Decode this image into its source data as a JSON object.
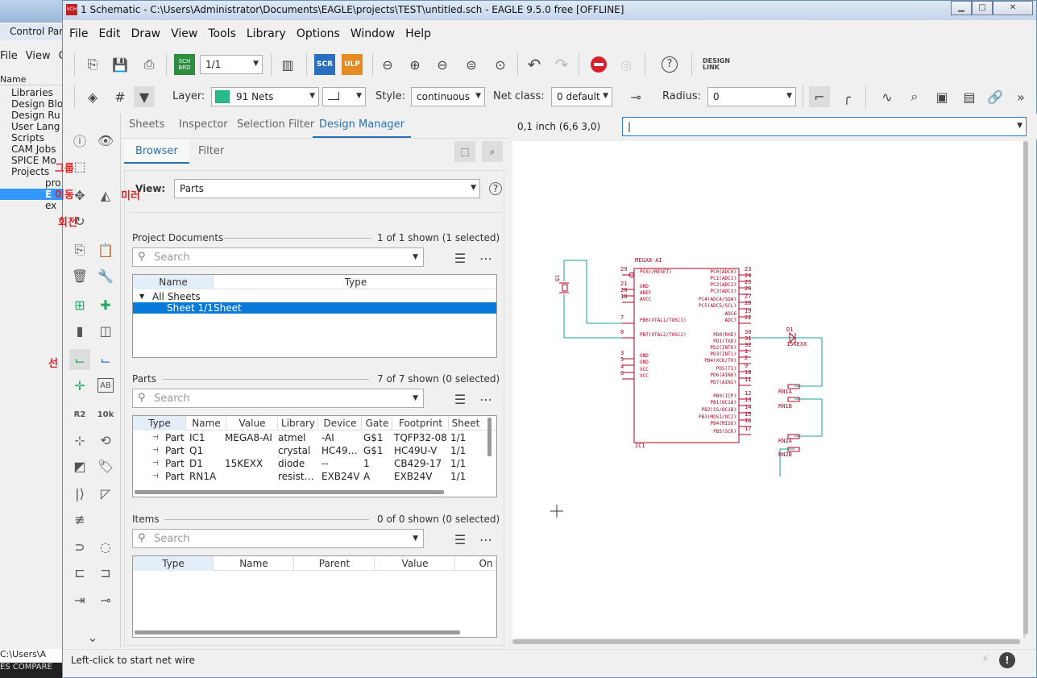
{
  "background_window": {
    "tab_label": "Control Par",
    "menu": [
      "File",
      "View",
      "G"
    ],
    "column_header": "Name",
    "tree": [
      "Libraries",
      "Design Blo",
      "Design Ru",
      "User Lang",
      "Scripts",
      "CAM Jobs",
      "SPICE Mo",
      "Projects",
      "pro",
      "E",
      "ex"
    ],
    "bottom_path": "C:\\Users\\A",
    "bottom_bar": "ES  COMPARE"
  },
  "korean_annotations": {
    "group": "그룹",
    "move": "이동",
    "mirror": "미러",
    "rotate": "회전",
    "line": "선"
  },
  "window": {
    "title": "1 Schematic - C:\\Users\\Administrator\\Documents\\EAGLE\\projects\\TEST\\untitled.sch - EAGLE 9.5.0 free [OFFLINE]",
    "icon_text": "SCH"
  },
  "menubar": [
    "File",
    "Edit",
    "Draw",
    "View",
    "Tools",
    "Library",
    "Options",
    "Window",
    "Help"
  ],
  "toolbar1": {
    "sheet_combo": "1/1",
    "scr_label": "SCR",
    "ulp_label": "ULP",
    "sch_brd_label": "SCH BRD",
    "design_link_label": "DESIGN LINK"
  },
  "toolbar2": {
    "layer_label": "Layer:",
    "layer_value": "91 Nets",
    "layer_color": "#2bbb8a",
    "style_label": "Style:",
    "style_value": "continuous",
    "netclass_label": "Net class:",
    "netclass_value": "0 default",
    "radius_label": "Radius:",
    "radius_value": "0"
  },
  "panel": {
    "tabs": [
      "Sheets",
      "Inspector",
      "Selection Filter",
      "Design Manager"
    ],
    "subtabs": [
      "Browser",
      "Filter"
    ],
    "view_label": "View:",
    "view_value": "Parts",
    "project_documents": {
      "title": "Project Documents",
      "count": "1 of 1 shown (1 selected)",
      "search_placeholder": "Search",
      "columns": [
        "Name",
        "Type"
      ],
      "rows": [
        {
          "name": "All Sheets"
        },
        {
          "name": "Sheet 1/1",
          "type": "Sheet"
        }
      ]
    },
    "parts": {
      "title": "Parts",
      "count": "7 of 7 shown (0 selected)",
      "search_placeholder": "Search",
      "columns": [
        "Type",
        "Name",
        "Value",
        "Library",
        "Device",
        "Gate",
        "Footprint",
        "Sheet"
      ],
      "rows": [
        {
          "type": "Part",
          "name": "IC1",
          "value": "MEGA8-AI",
          "library": "atmel",
          "device": "-AI",
          "gate": "G$1",
          "footprint": "TQFP32-08",
          "sheet": "1/1"
        },
        {
          "type": "Part",
          "name": "Q1",
          "value": "",
          "library": "crystal",
          "device": "HC49…",
          "gate": "G$1",
          "footprint": "HC49U-V",
          "sheet": "1/1"
        },
        {
          "type": "Part",
          "name": "D1",
          "value": "15KEXX",
          "library": "diode",
          "device": "--",
          "gate": "1",
          "footprint": "CB429-17",
          "sheet": "1/1"
        },
        {
          "type": "Part",
          "name": "RN1A",
          "value": "",
          "library": "resist…",
          "device": "EXB24V",
          "gate": "A",
          "footprint": "EXB24V",
          "sheet": "1/1"
        }
      ]
    },
    "items": {
      "title": "Items",
      "count": "0 of 0 shown (0 selected)",
      "search_placeholder": "Search",
      "columns": [
        "Type",
        "Name",
        "Parent",
        "Value",
        "On"
      ]
    }
  },
  "coordinate_readout": "0,1 inch (6,6 3,0)",
  "command_input": "|",
  "schematic": {
    "ic_name": "MEGA8-AI",
    "ic_ref": "IC1",
    "crystal": "Q1",
    "diode": "D1",
    "diode_value": "15KEXX",
    "left_pins": [
      {
        "num": "29",
        "name": "PC6(/RESET)"
      },
      {
        "num": "21",
        "name": "GND"
      },
      {
        "num": "20",
        "name": "AREF"
      },
      {
        "num": "18",
        "name": "AVCC"
      },
      {
        "num": "7",
        "name": "PB6(XTAL1/TOSC1)"
      },
      {
        "num": "8",
        "name": "PB7(XTAL2/TOSC2)"
      },
      {
        "num": "3",
        "name": "GND"
      },
      {
        "num": "5",
        "name": "GND"
      },
      {
        "num": "4",
        "name": "VCC"
      },
      {
        "num": "6",
        "name": "VCC"
      }
    ],
    "right_pins": [
      {
        "num": "23",
        "name": "PC0(ADC0)"
      },
      {
        "num": "24",
        "name": "PC1(ADC1)"
      },
      {
        "num": "25",
        "name": "PC2(ADC2)"
      },
      {
        "num": "26",
        "name": "PC3(ADC3)"
      },
      {
        "num": "27",
        "name": "PC4(ADC4/SDA)"
      },
      {
        "num": "28",
        "name": "PC5(ADC5/SCL)"
      },
      {
        "num": "19",
        "name": "ADC6"
      },
      {
        "num": "22",
        "name": "ADC7"
      },
      {
        "num": "30",
        "name": "PD0(RXD)"
      },
      {
        "num": "31",
        "name": "PD1(TXD)"
      },
      {
        "num": "32",
        "name": "PD2(INT0)"
      },
      {
        "num": "1",
        "name": "PD3(INT1)"
      },
      {
        "num": "2",
        "name": "PD4(XCK/T0)"
      },
      {
        "num": "9",
        "name": "PD5(T1)"
      },
      {
        "num": "10",
        "name": "PD6(AIN0)"
      },
      {
        "num": "11",
        "name": "PD7(AIN1)"
      },
      {
        "num": "12",
        "name": "PB0(ICP)"
      },
      {
        "num": "13",
        "name": "PB1(OC1A)"
      },
      {
        "num": "14",
        "name": "PB2(SS/OC1B)"
      },
      {
        "num": "15",
        "name": "PB3(MOSI/OC2)"
      },
      {
        "num": "16",
        "name": "PB4(MISO)"
      },
      {
        "num": "17",
        "name": "PB5(SCK)"
      }
    ],
    "resistors": [
      "RN1A",
      "RN1B",
      "RN2A",
      "RN2B"
    ]
  },
  "status_text": "Left-click to start net wire"
}
